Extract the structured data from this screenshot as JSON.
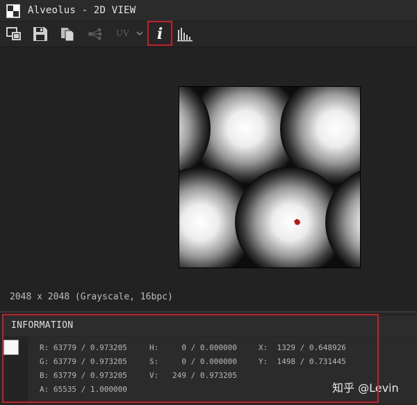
{
  "window": {
    "title": "Alveolus - 2D VIEW",
    "app_icon": "checkerboard-icon"
  },
  "toolbar": {
    "buttons": [
      {
        "name": "export-view-icon",
        "enabled": true
      },
      {
        "name": "save-icon",
        "enabled": true
      },
      {
        "name": "copy-icon",
        "enabled": true
      },
      {
        "name": "share-graph-icon",
        "enabled": false
      }
    ],
    "uv_label": "UV",
    "info_glyph": "i",
    "histogram_icon": "histogram-icon",
    "active_button": "information"
  },
  "viewer": {
    "dimensions_text": "2048 x 2048 (Grayscale, 16bpc)",
    "picker_marker_color": "#c01515"
  },
  "information_panel": {
    "title": "INFORMATION",
    "swatch_color": "#f8f8f8",
    "rgba": {
      "r": "R: 63779 / 0.973205",
      "g": "G: 63779 / 0.973205",
      "b": "B: 63779 / 0.973205",
      "a": "A: 65535 / 1.000000"
    },
    "hsv": {
      "h": "H:     0 / 0.000000",
      "s": "S:     0 / 0.000000",
      "v": "V:   249 / 0.973205"
    },
    "position": {
      "x": "X:  1329 / 0.648926",
      "y": "Y:  1498 / 0.731445"
    }
  },
  "watermark": "知乎 @Levin",
  "colors": {
    "highlight": "#c4202c",
    "background": "#1f1f1f"
  }
}
